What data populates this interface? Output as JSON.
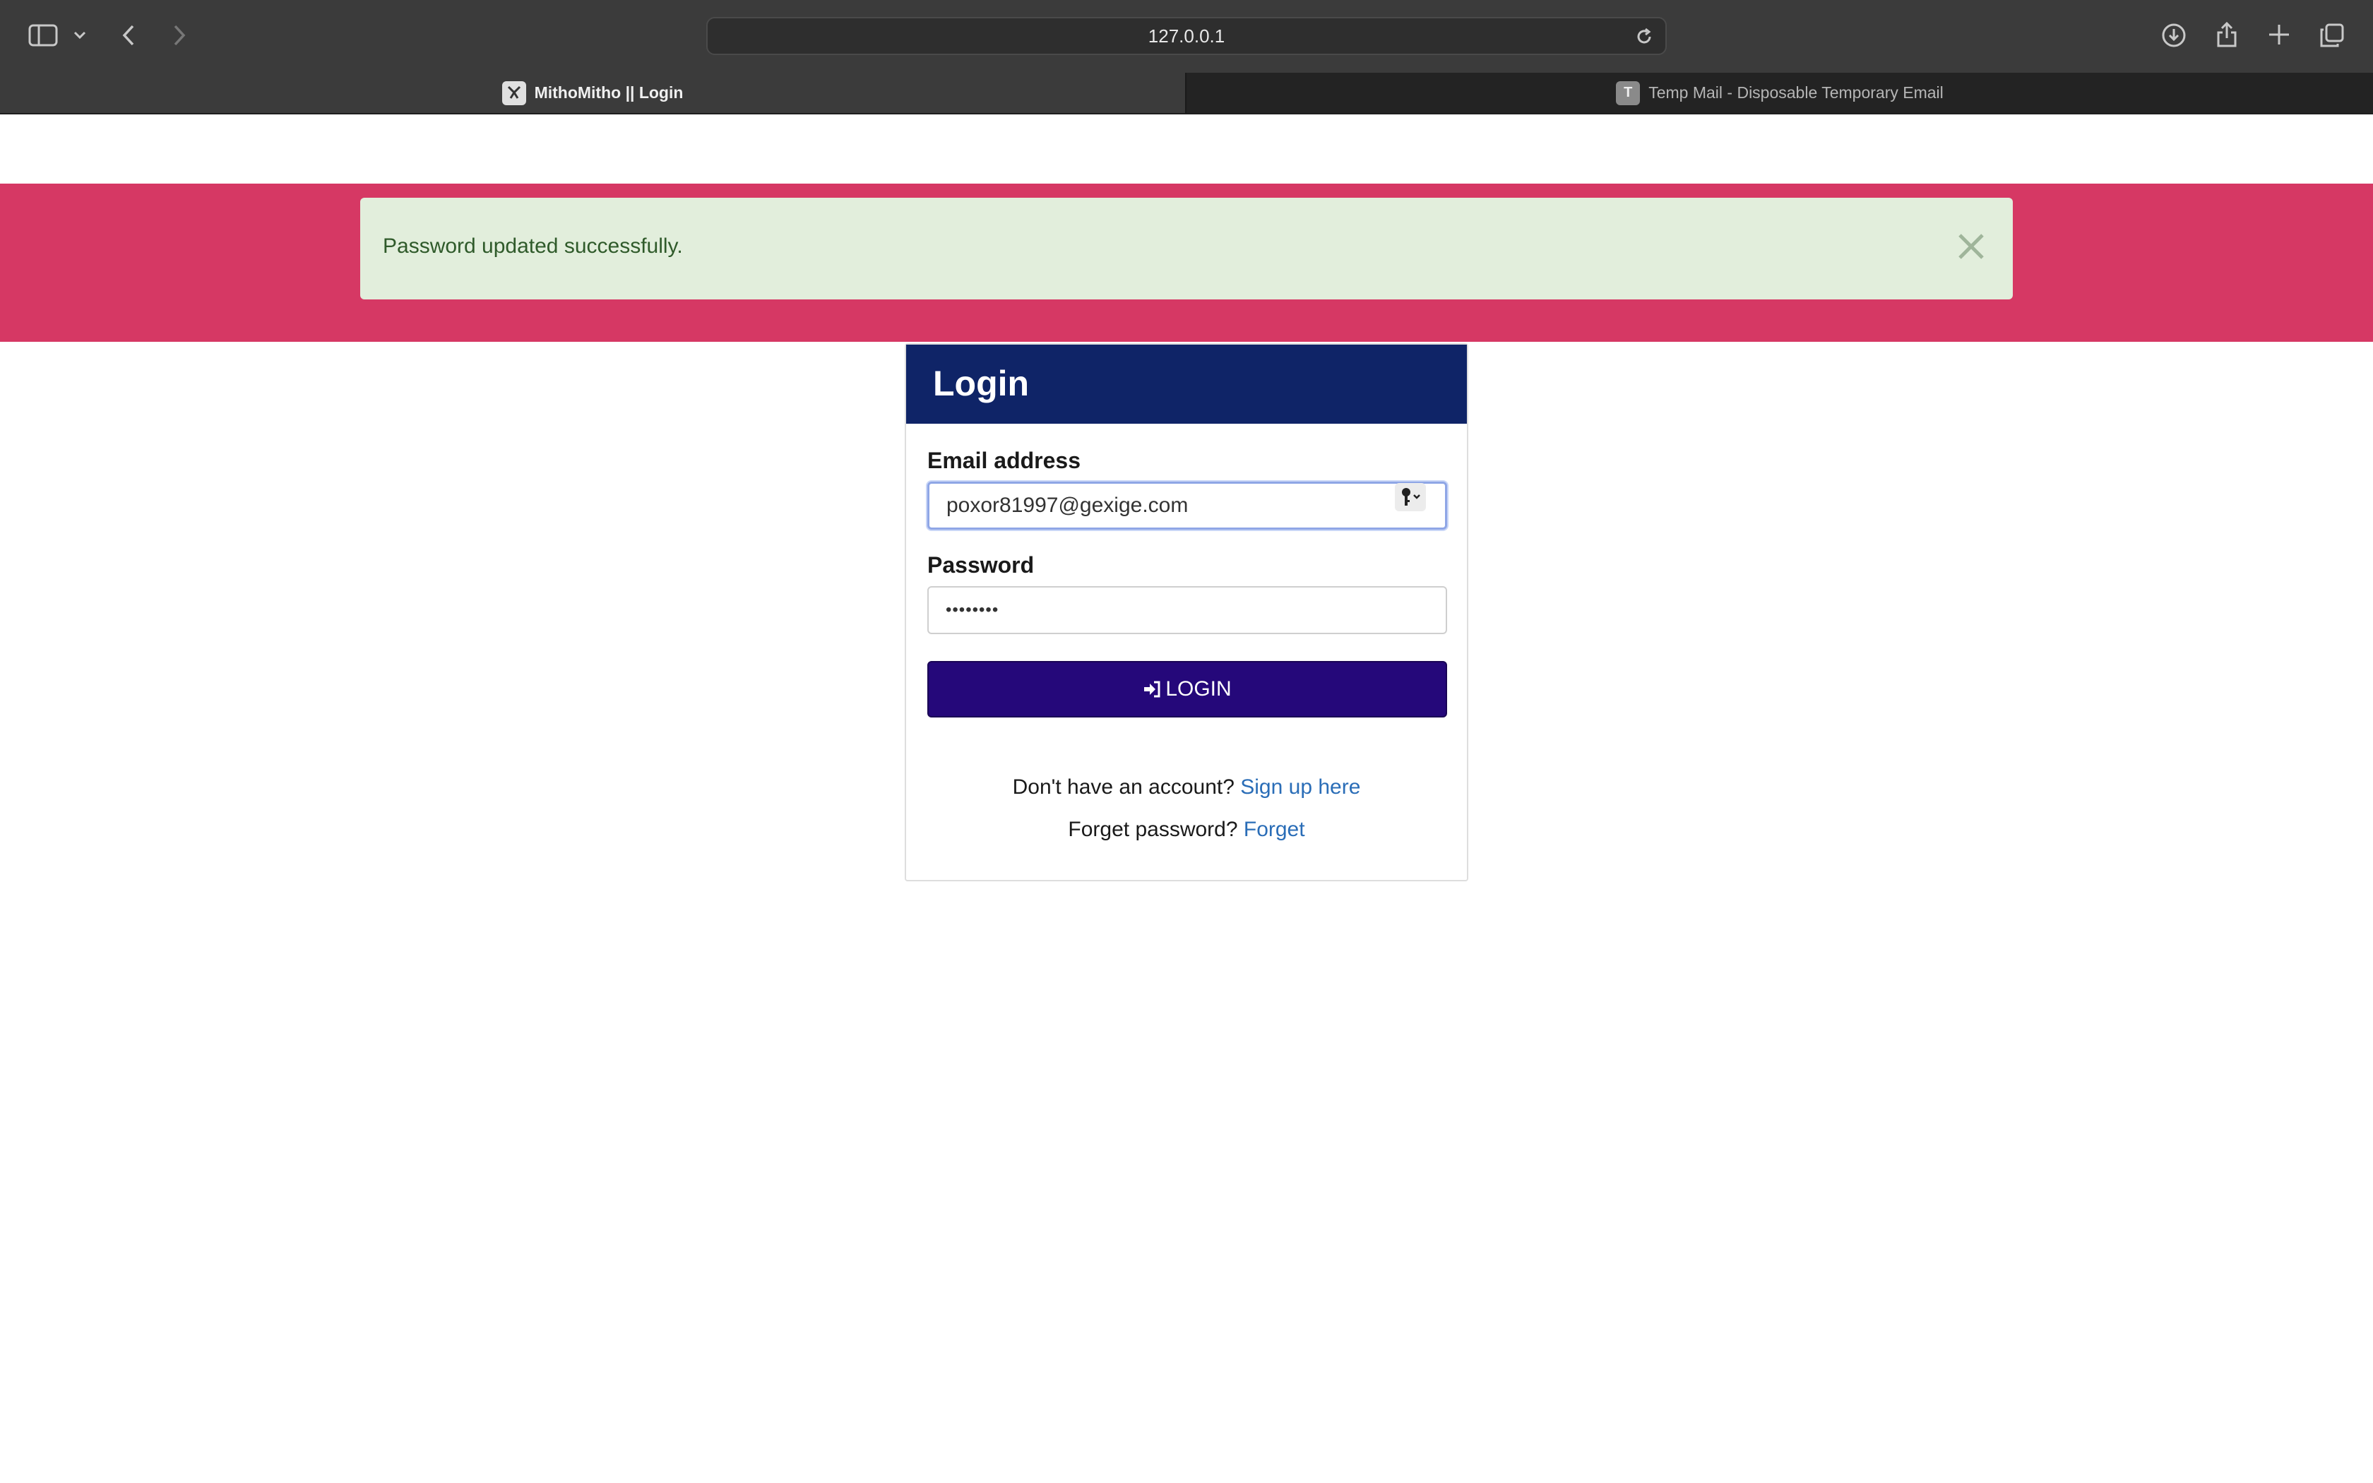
{
  "browser": {
    "url": "127.0.0.1",
    "tabs": [
      {
        "label": "MithoMitho || Login",
        "favicon": "mithomitho-favicon",
        "active": true
      },
      {
        "label": "Temp Mail - Disposable Temporary Email",
        "favicon_letter": "T",
        "active": false
      }
    ]
  },
  "alert": {
    "message": "Password updated successfully.",
    "close_symbol": "×"
  },
  "login": {
    "title": "Login",
    "email_label": "Email address",
    "email_value": "poxor81997@gexige.com",
    "password_label": "Password",
    "password_masked": "••••••••",
    "button_label": "LOGIN",
    "signup_prompt": "Don't have an account?",
    "signup_link": "Sign up here",
    "forget_prompt": "Forget password?",
    "forget_link": "Forget"
  },
  "colors": {
    "banner": "#d63864",
    "alert_bg": "#e2eedc",
    "header": "#0f2467",
    "button": "#25087a",
    "link": "#2a6db7"
  }
}
